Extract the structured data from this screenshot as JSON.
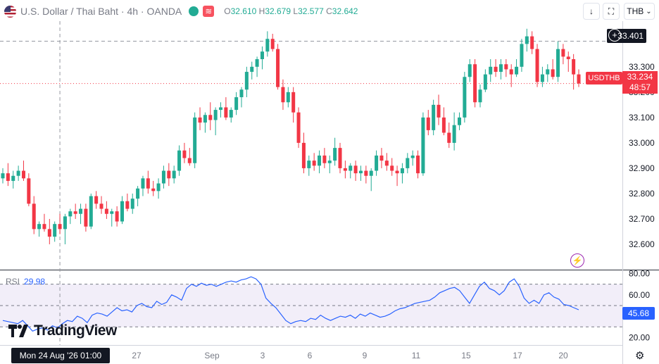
{
  "header": {
    "title": "U.S. Dollar / Thai Baht · 4h · OANDA",
    "open_label": "O",
    "open": "32.610",
    "high_label": "H",
    "high": "32.679",
    "low_label": "L",
    "low": "32.577",
    "close_label": "C",
    "close": "32.642",
    "wave_icon": "≋"
  },
  "toolbar": {
    "download_icon": "↓",
    "fullscreen_icon": "⛶",
    "currency": "THB",
    "currency_icon": "⌄"
  },
  "crosshair": {
    "price": "33.401",
    "time": "Mon 24 Aug '26   01:00",
    "plus_icon": "+"
  },
  "current": {
    "symbol": "USDTHB",
    "price": "33.234",
    "countdown": "48:57"
  },
  "rsi": {
    "label": "RSI",
    "value": "29.98",
    "last": "45.68"
  },
  "brand": {
    "name": "TradingView"
  },
  "colors": {
    "up": "#22ab94",
    "down": "#f23645",
    "rsi_line": "#2962ff",
    "rsi_band": "#7e57c2"
  },
  "chart_data": [
    {
      "type": "candlestick",
      "title": "U.S. Dollar / Thai Baht, 4h, OANDA",
      "ylim": [
        32.5,
        33.48
      ],
      "yticks": [
        "33.300",
        "33.200",
        "33.100",
        "33.000",
        "32.900",
        "32.800",
        "32.700",
        "32.600"
      ],
      "xticks": [
        "27",
        "Sep",
        "3",
        "6",
        "9",
        "11",
        "15",
        "17",
        "20"
      ],
      "ohlc": [
        [
          32.86,
          32.9,
          32.84,
          32.88
        ],
        [
          32.88,
          32.92,
          32.83,
          32.85
        ],
        [
          32.85,
          32.89,
          32.82,
          32.87
        ],
        [
          32.87,
          32.91,
          32.85,
          32.89
        ],
        [
          32.89,
          32.93,
          32.85,
          32.86
        ],
        [
          32.86,
          32.88,
          32.75,
          32.76
        ],
        [
          32.76,
          32.79,
          32.64,
          32.66
        ],
        [
          32.66,
          32.69,
          32.63,
          32.68
        ],
        [
          32.68,
          32.72,
          32.65,
          32.66
        ],
        [
          32.66,
          32.7,
          32.6,
          32.63
        ],
        [
          32.63,
          32.69,
          32.61,
          32.68
        ],
        [
          32.68,
          32.72,
          32.64,
          32.66
        ],
        [
          32.66,
          32.72,
          32.6,
          32.71
        ],
        [
          32.71,
          32.74,
          32.68,
          32.73
        ],
        [
          32.73,
          32.76,
          32.7,
          32.72
        ],
        [
          32.72,
          32.76,
          32.68,
          32.74
        ],
        [
          32.74,
          32.76,
          32.65,
          32.67
        ],
        [
          32.67,
          32.8,
          32.66,
          32.79
        ],
        [
          32.79,
          32.81,
          32.74,
          32.76
        ],
        [
          32.76,
          32.79,
          32.72,
          32.74
        ],
        [
          32.74,
          32.77,
          32.7,
          32.72
        ],
        [
          32.72,
          32.74,
          32.67,
          32.73
        ],
        [
          32.73,
          32.75,
          32.67,
          32.69
        ],
        [
          32.69,
          32.79,
          32.68,
          32.77
        ],
        [
          32.77,
          32.8,
          32.73,
          32.74
        ],
        [
          32.74,
          32.8,
          32.72,
          32.78
        ],
        [
          32.78,
          32.83,
          32.75,
          32.82
        ],
        [
          32.82,
          32.87,
          32.79,
          32.86
        ],
        [
          32.86,
          32.89,
          32.8,
          32.82
        ],
        [
          32.82,
          32.85,
          32.79,
          32.81
        ],
        [
          32.81,
          32.86,
          32.78,
          32.84
        ],
        [
          32.84,
          32.91,
          32.82,
          32.89
        ],
        [
          32.89,
          32.92,
          32.83,
          32.86
        ],
        [
          32.86,
          32.91,
          32.84,
          32.89
        ],
        [
          32.89,
          32.99,
          32.87,
          32.97
        ],
        [
          32.97,
          33.0,
          32.92,
          32.94
        ],
        [
          32.94,
          32.98,
          32.91,
          32.92
        ],
        [
          32.92,
          33.12,
          32.9,
          33.1
        ],
        [
          33.1,
          33.14,
          33.05,
          33.08
        ],
        [
          33.08,
          33.12,
          33.04,
          33.11
        ],
        [
          33.11,
          33.16,
          33.05,
          33.09
        ],
        [
          33.09,
          33.14,
          33.03,
          33.13
        ],
        [
          33.13,
          33.16,
          33.1,
          33.14
        ],
        [
          33.14,
          33.18,
          33.09,
          33.1
        ],
        [
          33.1,
          33.14,
          33.08,
          33.13
        ],
        [
          33.13,
          33.2,
          33.11,
          33.18
        ],
        [
          33.18,
          33.22,
          33.14,
          33.21
        ],
        [
          33.21,
          33.3,
          33.18,
          33.28
        ],
        [
          33.28,
          33.32,
          33.25,
          33.3
        ],
        [
          33.3,
          33.34,
          33.26,
          33.33
        ],
        [
          33.33,
          33.38,
          33.29,
          33.36
        ],
        [
          33.36,
          33.44,
          33.34,
          33.41
        ],
        [
          33.41,
          33.43,
          33.36,
          33.37
        ],
        [
          33.37,
          33.39,
          33.21,
          33.22
        ],
        [
          33.22,
          33.25,
          33.13,
          33.16
        ],
        [
          33.16,
          33.22,
          33.14,
          33.2
        ],
        [
          33.2,
          33.22,
          33.08,
          33.12
        ],
        [
          33.12,
          33.14,
          32.98,
          33.0
        ],
        [
          33.0,
          33.04,
          32.88,
          32.9
        ],
        [
          32.9,
          32.95,
          32.87,
          32.93
        ],
        [
          32.93,
          32.96,
          32.89,
          32.91
        ],
        [
          32.91,
          32.97,
          32.88,
          32.95
        ],
        [
          32.95,
          32.98,
          32.9,
          32.92
        ],
        [
          32.92,
          32.95,
          32.88,
          32.93
        ],
        [
          32.93,
          33.02,
          32.91,
          32.98
        ],
        [
          32.98,
          33.0,
          32.88,
          32.9
        ],
        [
          32.9,
          32.93,
          32.86,
          32.89
        ],
        [
          32.89,
          32.92,
          32.86,
          32.91
        ],
        [
          32.91,
          32.93,
          32.85,
          32.88
        ],
        [
          32.88,
          32.91,
          32.85,
          32.89
        ],
        [
          32.89,
          32.91,
          32.84,
          32.87
        ],
        [
          32.87,
          32.9,
          32.81,
          32.89
        ],
        [
          32.89,
          32.97,
          32.87,
          32.95
        ],
        [
          32.95,
          32.98,
          32.9,
          32.93
        ],
        [
          32.93,
          32.96,
          32.89,
          32.91
        ],
        [
          32.91,
          32.94,
          32.87,
          32.89
        ],
        [
          32.89,
          32.91,
          32.83,
          32.88
        ],
        [
          32.88,
          32.92,
          32.84,
          32.9
        ],
        [
          32.9,
          32.96,
          32.88,
          32.94
        ],
        [
          32.94,
          32.97,
          32.91,
          32.95
        ],
        [
          32.95,
          32.97,
          32.86,
          32.88
        ],
        [
          32.88,
          33.12,
          32.87,
          33.1
        ],
        [
          33.1,
          33.13,
          33.03,
          33.05
        ],
        [
          33.05,
          33.17,
          33.03,
          33.15
        ],
        [
          33.15,
          33.19,
          33.07,
          33.1
        ],
        [
          33.1,
          33.14,
          33.03,
          33.04
        ],
        [
          33.04,
          33.08,
          32.98,
          33.0
        ],
        [
          33.0,
          33.12,
          32.97,
          33.07
        ],
        [
          33.07,
          33.12,
          33.05,
          33.1
        ],
        [
          33.1,
          33.28,
          33.08,
          33.26
        ],
        [
          33.26,
          33.33,
          33.24,
          33.31
        ],
        [
          33.31,
          33.33,
          33.14,
          33.16
        ],
        [
          33.16,
          33.23,
          33.14,
          33.21
        ],
        [
          33.21,
          33.29,
          33.2,
          33.27
        ],
        [
          33.27,
          33.33,
          33.24,
          33.3
        ],
        [
          33.3,
          33.33,
          33.26,
          33.28
        ],
        [
          33.28,
          33.33,
          33.25,
          33.31
        ],
        [
          33.31,
          33.33,
          33.26,
          33.29
        ],
        [
          33.29,
          33.31,
          33.22,
          33.27
        ],
        [
          33.27,
          33.33,
          33.26,
          33.3
        ],
        [
          33.3,
          33.41,
          33.28,
          33.39
        ],
        [
          33.39,
          33.45,
          33.36,
          33.42
        ],
        [
          33.42,
          33.44,
          33.35,
          33.37
        ],
        [
          33.37,
          33.39,
          33.22,
          33.24
        ],
        [
          33.24,
          33.3,
          33.22,
          33.27
        ],
        [
          33.27,
          33.31,
          33.24,
          33.29
        ],
        [
          33.29,
          33.33,
          33.25,
          33.26
        ],
        [
          33.26,
          33.4,
          33.24,
          33.37
        ],
        [
          33.37,
          33.39,
          33.31,
          33.34
        ],
        [
          33.34,
          33.36,
          33.28,
          33.33
        ],
        [
          33.33,
          33.35,
          33.21,
          33.27
        ],
        [
          33.27,
          33.29,
          33.22,
          33.234
        ]
      ]
    },
    {
      "type": "line",
      "title": "RSI",
      "ylim": [
        13,
        83
      ],
      "yticks": [
        "80.00",
        "60.00",
        "40.00",
        "20.00"
      ],
      "bands": [
        70,
        50,
        30
      ],
      "values": [
        36,
        35,
        34,
        33,
        36,
        31,
        26,
        28,
        29,
        27,
        31,
        29,
        33,
        36,
        35,
        40,
        38,
        34,
        41,
        43,
        42,
        40,
        44,
        48,
        45,
        46,
        44,
        50,
        52,
        49,
        48,
        54,
        51,
        53,
        60,
        58,
        55,
        66,
        70,
        68,
        71,
        69,
        70,
        68,
        70,
        72,
        73,
        72,
        74,
        75,
        77,
        75,
        70,
        57,
        52,
        48,
        42,
        36,
        33,
        35,
        36,
        35,
        38,
        37,
        41,
        38,
        36,
        38,
        40,
        39,
        41,
        38,
        42,
        40,
        43,
        41,
        39,
        40,
        42,
        45,
        47,
        48,
        50,
        52,
        53,
        54,
        55,
        58,
        62,
        64,
        66,
        67,
        64,
        58,
        52,
        60,
        68,
        72,
        66,
        64,
        60,
        64,
        72,
        75,
        68,
        57,
        52,
        55,
        52,
        60,
        62,
        58,
        56,
        51,
        50,
        48,
        46
      ]
    }
  ]
}
